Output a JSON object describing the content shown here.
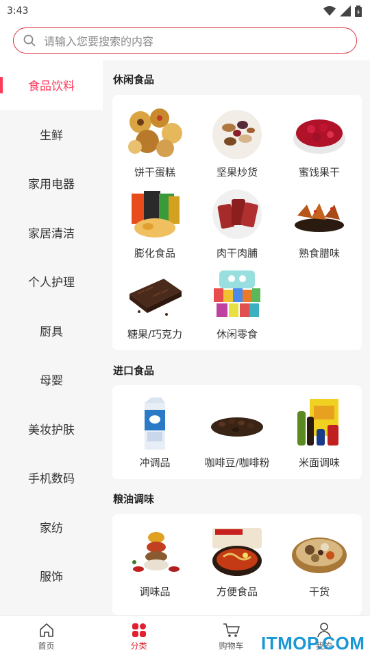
{
  "status_bar": {
    "time": "3:43",
    "icons": [
      "wifi-icon",
      "signal-icon",
      "battery-icon"
    ]
  },
  "search": {
    "placeholder": "请输入您要搜索的内容"
  },
  "sidebar": {
    "items": [
      {
        "label": "食品饮料",
        "active": true
      },
      {
        "label": "生鲜"
      },
      {
        "label": "家用电器"
      },
      {
        "label": "家居清洁"
      },
      {
        "label": "个人护理"
      },
      {
        "label": "厨具"
      },
      {
        "label": "母婴"
      },
      {
        "label": "美妆护肤"
      },
      {
        "label": "手机数码"
      },
      {
        "label": "家纺"
      },
      {
        "label": "服饰"
      }
    ]
  },
  "sections": [
    {
      "title": "休闲食品",
      "items": [
        "饼干蛋糕",
        "坚果炒货",
        "蜜饯果干",
        "膨化食品",
        "肉干肉脯",
        "熟食腊味",
        "糖果/巧克力",
        "休闲零食"
      ]
    },
    {
      "title": "进口食品",
      "items": [
        "冲调品",
        "咖啡豆/咖啡粉",
        "米面调味"
      ]
    },
    {
      "title": "粮油调味",
      "items": [
        "调味品",
        "方便食品",
        "干货"
      ]
    }
  ],
  "tabbar": {
    "items": [
      {
        "label": "首页",
        "icon": "home-icon"
      },
      {
        "label": "分类",
        "icon": "category-icon",
        "active": true
      },
      {
        "label": "购物车",
        "icon": "cart-icon"
      },
      {
        "label": "我的",
        "icon": "user-icon"
      }
    ]
  },
  "watermark": "ITMOP.COM",
  "colors": {
    "accent": "#ff3b5c",
    "search_border": "#e0303c",
    "watermark": "#1a97d4"
  }
}
